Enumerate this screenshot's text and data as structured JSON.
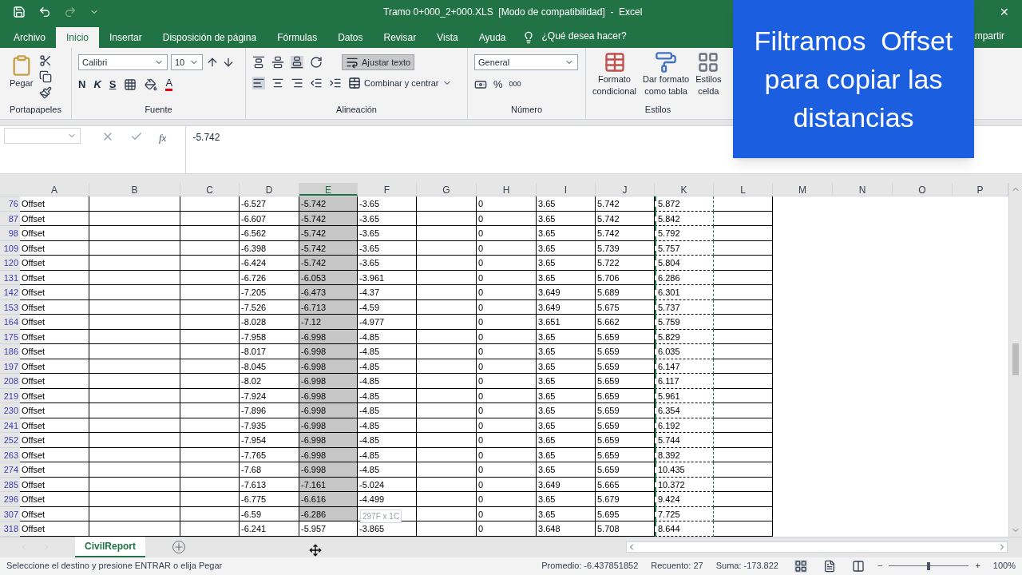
{
  "title_bar": {
    "title": "Tramo 0+000_2+000.XLS  [Modo de compatibilidad]  -  Excel",
    "close": "✕"
  },
  "menu_tabs": [
    {
      "label": "Archivo",
      "selected": false
    },
    {
      "label": "Inicio",
      "selected": true
    },
    {
      "label": "Insertar",
      "selected": false
    },
    {
      "label": "Disposición de página",
      "selected": false
    },
    {
      "label": "Fórmulas",
      "selected": false
    },
    {
      "label": "Datos",
      "selected": false
    },
    {
      "label": "Revisar",
      "selected": false
    },
    {
      "label": "Vista",
      "selected": false
    },
    {
      "label": "Ayuda",
      "selected": false
    }
  ],
  "tell_me": "¿Qué desea hacer?",
  "share": "mpartir",
  "ribbon": {
    "paste": "Pegar",
    "clipboard_group": "Portapapeles",
    "font": "Calibri",
    "font_size": "10",
    "bold": "N",
    "italic": "K",
    "underline": "S",
    "font_color": "A",
    "font_group": "Fuente",
    "wrap_text": {
      "label": "Ajustar texto",
      "on": true
    },
    "merge": "Combinar y centrar",
    "alignment_group": "Alineación",
    "number_format": "General",
    "percent": "%",
    "thousands": "000",
    "number_group": "Número",
    "conditional_format": [
      "Formato",
      "condicional"
    ],
    "format_table": [
      "Dar formato",
      "como tabla"
    ],
    "cell_styles": [
      "Estilos",
      "celda"
    ],
    "styles_group": "Estilos"
  },
  "formula_bar": {
    "fx": "fx",
    "value": "-5.742"
  },
  "columns": [
    {
      "label": "A",
      "selected": false,
      "bordered": true,
      "copied": false
    },
    {
      "label": "B",
      "selected": false,
      "bordered": true,
      "copied": false
    },
    {
      "label": "C",
      "selected": false,
      "bordered": true,
      "copied": false
    },
    {
      "label": "D",
      "selected": false,
      "bordered": true,
      "copied": false
    },
    {
      "label": "E",
      "selected": true,
      "bordered": true,
      "copied": false
    },
    {
      "label": "F",
      "selected": false,
      "bordered": true,
      "copied": false
    },
    {
      "label": "G",
      "selected": false,
      "bordered": true,
      "copied": false
    },
    {
      "label": "H",
      "selected": false,
      "bordered": true,
      "copied": false
    },
    {
      "label": "I",
      "selected": false,
      "bordered": true,
      "copied": false
    },
    {
      "label": "J",
      "selected": false,
      "bordered": true,
      "copied": false
    },
    {
      "label": "K",
      "selected": false,
      "bordered": true,
      "copied": true
    },
    {
      "label": "L",
      "selected": false,
      "bordered": true,
      "copied": false
    },
    {
      "label": "M",
      "selected": false
    },
    {
      "label": "N",
      "selected": false
    },
    {
      "label": "O",
      "selected": false
    },
    {
      "label": "P",
      "selected": false
    }
  ],
  "filtered": true,
  "rows": [
    {
      "num": "76",
      "selected": true,
      "cells": {
        "A": "Offset",
        "D": "-6.527",
        "E": "-5.742",
        "F": "-3.65",
        "H": "0",
        "I": "3.65",
        "J": "5.742",
        "K": "5.872"
      }
    },
    {
      "num": "87",
      "selected": true,
      "cells": {
        "A": "Offset",
        "D": "-6.607",
        "E": "-5.742",
        "F": "-3.65",
        "H": "0",
        "I": "3.65",
        "J": "5.742",
        "K": "5.842"
      }
    },
    {
      "num": "98",
      "selected": true,
      "cells": {
        "A": "Offset",
        "D": "-6.562",
        "E": "-5.742",
        "F": "-3.65",
        "H": "0",
        "I": "3.65",
        "J": "5.742",
        "K": "5.792"
      }
    },
    {
      "num": "109",
      "selected": true,
      "cells": {
        "A": "Offset",
        "D": "-6.398",
        "E": "-5.742",
        "F": "-3.65",
        "H": "0",
        "I": "3.65",
        "J": "5.739",
        "K": "5.757"
      }
    },
    {
      "num": "120",
      "selected": true,
      "cells": {
        "A": "Offset",
        "D": "-6.424",
        "E": "-5.742",
        "F": "-3.65",
        "H": "0",
        "I": "3.65",
        "J": "5.722",
        "K": "5.804"
      }
    },
    {
      "num": "131",
      "selected": true,
      "cells": {
        "A": "Offset",
        "D": "-6.726",
        "E": "-6.053",
        "F": "-3.961",
        "H": "0",
        "I": "3.65",
        "J": "5.706",
        "K": "6.286"
      }
    },
    {
      "num": "142",
      "selected": true,
      "cells": {
        "A": "Offset",
        "D": "-7.205",
        "E": "-6.473",
        "F": "-4.37",
        "H": "0",
        "I": "3.649",
        "J": "5.689",
        "K": "6.301"
      }
    },
    {
      "num": "153",
      "selected": true,
      "cells": {
        "A": "Offset",
        "D": "-7.526",
        "E": "-6.713",
        "F": "-4.59",
        "H": "0",
        "I": "3.649",
        "J": "5.675",
        "K": "5.737"
      }
    },
    {
      "num": "164",
      "selected": true,
      "cells": {
        "A": "Offset",
        "D": "-8.028",
        "E": "-7.12",
        "F": "-4.977",
        "H": "0",
        "I": "3.651",
        "J": "5.662",
        "K": "5.759"
      }
    },
    {
      "num": "175",
      "selected": true,
      "cells": {
        "A": "Offset",
        "D": "-7.958",
        "E": "-6.998",
        "F": "-4.85",
        "H": "0",
        "I": "3.65",
        "J": "5.659",
        "K": "5.829"
      }
    },
    {
      "num": "186",
      "selected": true,
      "cells": {
        "A": "Offset",
        "D": "-8.017",
        "E": "-6.998",
        "F": "-4.85",
        "H": "0",
        "I": "3.65",
        "J": "5.659",
        "K": "6.035"
      }
    },
    {
      "num": "197",
      "selected": true,
      "cells": {
        "A": "Offset",
        "D": "-8.045",
        "E": "-6.998",
        "F": "-4.85",
        "H": "0",
        "I": "3.65",
        "J": "5.659",
        "K": "6.147"
      }
    },
    {
      "num": "208",
      "selected": true,
      "cells": {
        "A": "Offset",
        "D": "-8.02",
        "E": "-6.998",
        "F": "-4.85",
        "H": "0",
        "I": "3.65",
        "J": "5.659",
        "K": "6.117"
      }
    },
    {
      "num": "219",
      "selected": true,
      "cells": {
        "A": "Offset",
        "D": "-7.924",
        "E": "-6.998",
        "F": "-4.85",
        "H": "0",
        "I": "3.65",
        "J": "5.659",
        "K": "5.961"
      }
    },
    {
      "num": "230",
      "selected": true,
      "cells": {
        "A": "Offset",
        "D": "-7.896",
        "E": "-6.998",
        "F": "-4.85",
        "H": "0",
        "I": "3.65",
        "J": "5.659",
        "K": "6.354"
      }
    },
    {
      "num": "241",
      "selected": true,
      "cells": {
        "A": "Offset",
        "D": "-7.935",
        "E": "-6.998",
        "F": "-4.85",
        "H": "0",
        "I": "3.65",
        "J": "5.659",
        "K": "6.192"
      }
    },
    {
      "num": "252",
      "selected": true,
      "cells": {
        "A": "Offset",
        "D": "-7.954",
        "E": "-6.998",
        "F": "-4.85",
        "H": "0",
        "I": "3.65",
        "J": "5.659",
        "K": "5.744"
      }
    },
    {
      "num": "263",
      "selected": true,
      "cells": {
        "A": "Offset",
        "D": "-7.765",
        "E": "-6.998",
        "F": "-4.85",
        "H": "0",
        "I": "3.65",
        "J": "5.659",
        "K": "8.392"
      }
    },
    {
      "num": "274",
      "selected": true,
      "cells": {
        "A": "Offset",
        "D": "-7.68",
        "E": "-6.998",
        "F": "-4.85",
        "H": "0",
        "I": "3.65",
        "J": "5.659",
        "K": "10.435"
      }
    },
    {
      "num": "285",
      "selected": true,
      "cells": {
        "A": "Offset",
        "D": "-7.613",
        "E": "-7.161",
        "F": "-5.024",
        "H": "0",
        "I": "3.649",
        "J": "5.665",
        "K": "10.372"
      }
    },
    {
      "num": "296",
      "selected": true,
      "cells": {
        "A": "Offset",
        "D": "-6.775",
        "E": "-6.616",
        "F": "-4.499",
        "H": "0",
        "I": "3.65",
        "J": "5.679",
        "K": "9.424"
      }
    },
    {
      "num": "307",
      "selected": true,
      "cells": {
        "A": "Offset",
        "D": "-6.59",
        "E": "-6.286",
        "H": "0",
        "I": "3.65",
        "J": "5.695",
        "K": "7.725"
      }
    },
    {
      "num": "318",
      "selected": false,
      "cells": {
        "A": "Offset",
        "D": "-6.241",
        "E": "-5.957",
        "F": "-3.865",
        "H": "0",
        "I": "3.648",
        "J": "5.708",
        "K": "8.644"
      }
    }
  ],
  "drag_tooltip": "297F x 1C",
  "sheet_tabs": [
    {
      "label": "CivilReport",
      "selected": true
    }
  ],
  "status_bar": {
    "message": "Seleccione el destino y presione ENTRAR o elija Pegar",
    "average": "Promedio: -6.437851852",
    "count": "Recuento: 27",
    "sum": "Suma: -173.822",
    "zoom": "100%",
    "zoom_out": "−",
    "zoom_in": "+",
    "zoom_level": {
      "level": 0.5
    }
  },
  "overlay_caption": [
    "Filtramos  Offset",
    "para copiar las",
    "distancias"
  ]
}
